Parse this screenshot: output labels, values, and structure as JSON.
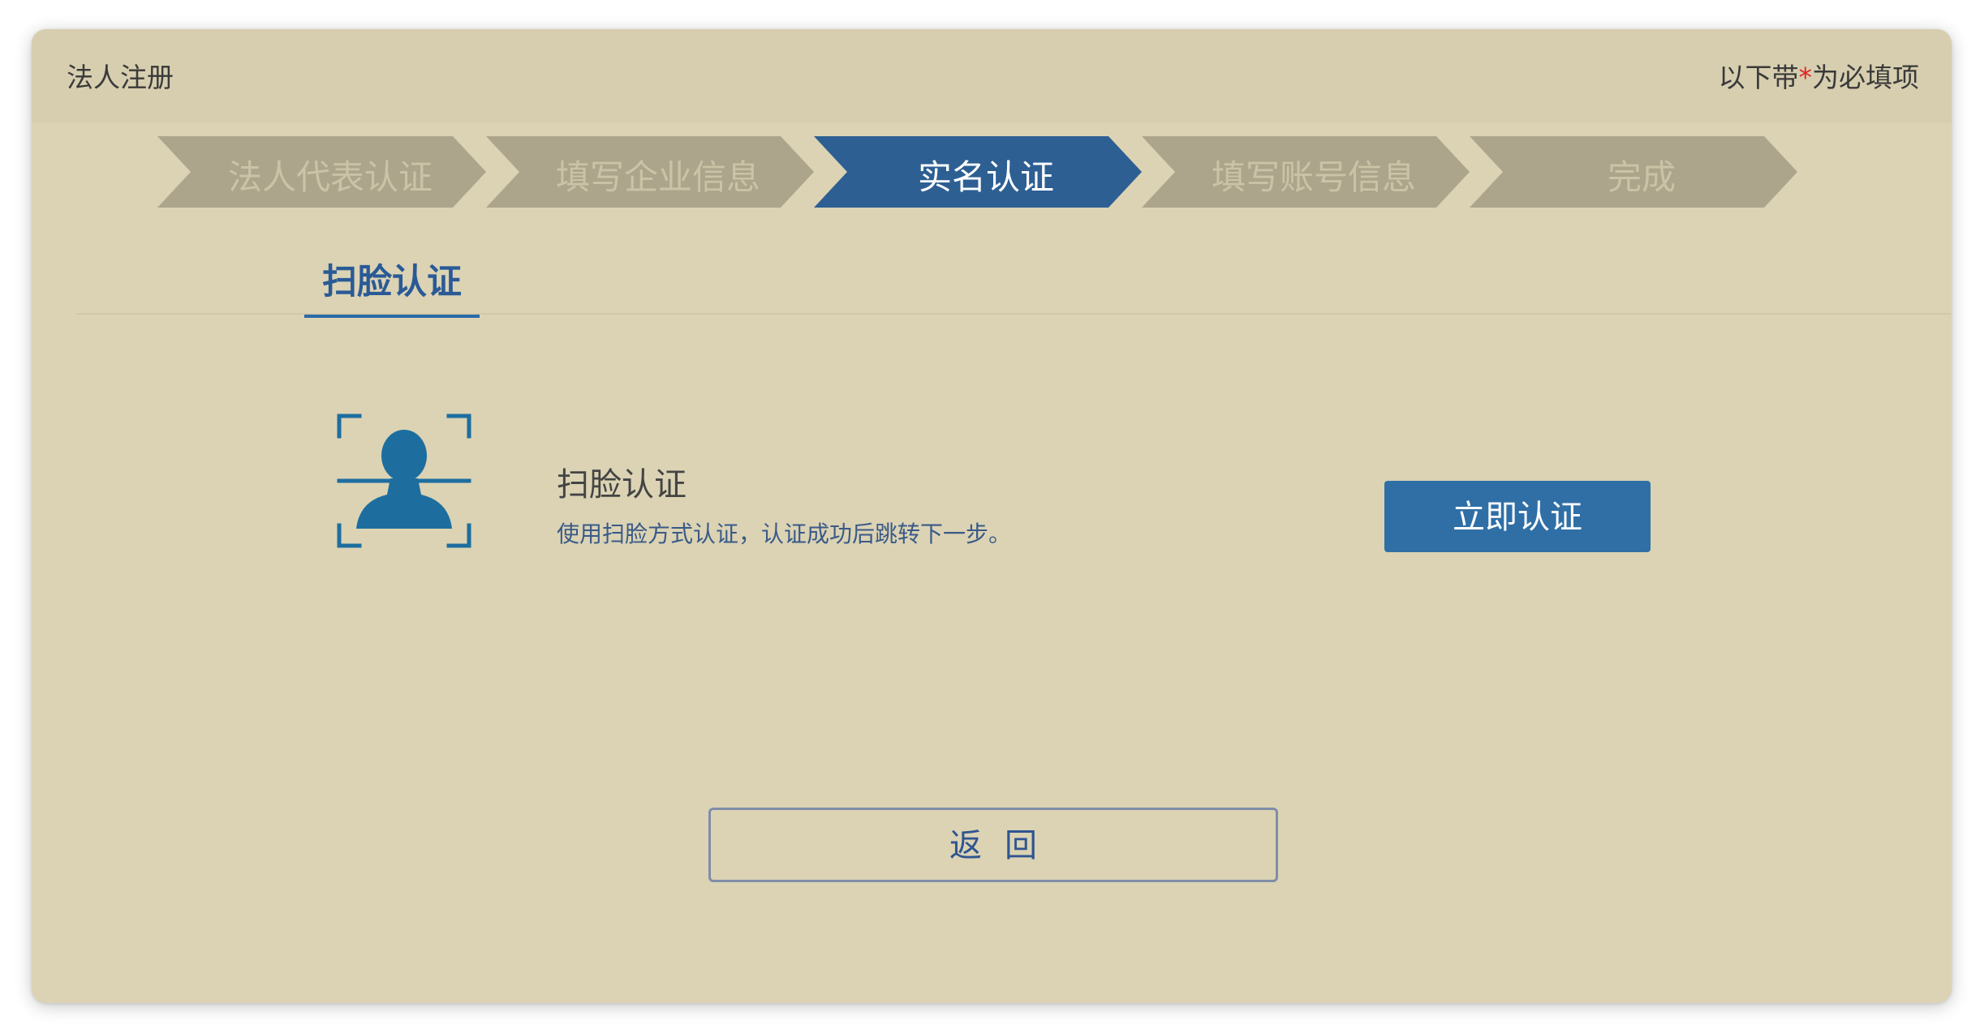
{
  "header": {
    "title": "法人注册",
    "note_prefix": "以下带",
    "note_mark": "*",
    "note_suffix": "为必填项"
  },
  "steps": [
    {
      "label": "法人代表认证",
      "active": false
    },
    {
      "label": "填写企业信息",
      "active": false
    },
    {
      "label": "实名认证",
      "active": true
    },
    {
      "label": "填写账号信息",
      "active": false
    },
    {
      "label": "完成",
      "active": false
    }
  ],
  "tabs": {
    "active_label": "扫脸认证"
  },
  "scan": {
    "title": "扫脸认证",
    "description": "使用扫脸方式认证，认证成功后跳转下一步。",
    "icon": "face-scan-icon"
  },
  "buttons": {
    "verify_label": "立即认证",
    "back_label": "返回"
  },
  "colors": {
    "background": "#dbd3b4",
    "step_inactive": "#aca58c",
    "step_active": "#2d5f93",
    "primary_button": "#2f6fa6",
    "icon": "#1d6e9f",
    "required_mark": "#e02424"
  }
}
